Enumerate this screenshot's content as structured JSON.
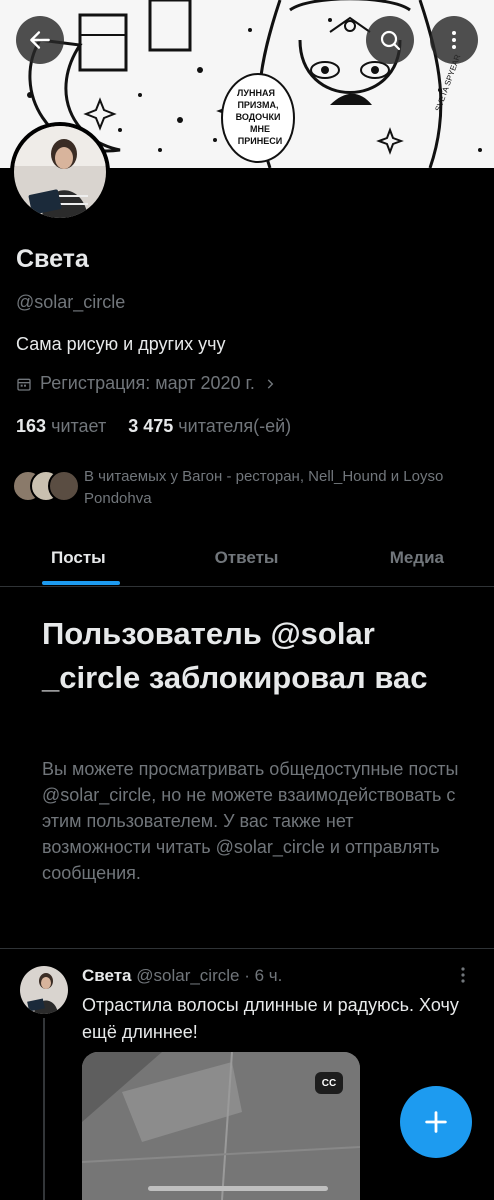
{
  "banner": {
    "speech_text": [
      "ЛУННАЯ",
      "ПРИЗМА,",
      "ВОДОЧКИ",
      "МНЕ",
      "ПРИНЕСИ"
    ],
    "artist_signature": "SVETA SPYEAR"
  },
  "profile": {
    "name": "Света",
    "handle": "@solar_circle",
    "bio": "Сама рисую и других учу",
    "joined": "Регистрация: март 2020 г.",
    "following_count": "163",
    "following_label": "читает",
    "followers_count": "3 475",
    "followers_label": "читателя(-ей)",
    "followers_you_know": "В читаемых у Вагон - ресторан, Nell_Hound и Loyso Pondohva"
  },
  "tabs": [
    {
      "label": "Посты",
      "active": true
    },
    {
      "label": "Ответы",
      "active": false
    },
    {
      "label": "Медиа",
      "active": false
    }
  ],
  "blocked": {
    "title": "Пользователь @solar _circle заблокировал вас",
    "description": "Вы можете просматривать общедоступные посты @solar_circle, но не можете взаимодействовать с этим пользователем. У вас также нет возможности читать @solar_circle и отправлять сообщения."
  },
  "post": {
    "author": "Света",
    "meta": "@solar_circle · 6 ч.",
    "text": "Отрастила волосы длинные и радуюсь. Хочу ещё длиннее!",
    "cc_label": "CC"
  },
  "colors": {
    "accent": "#1d9bf0",
    "background": "#000000",
    "text_primary": "#e7e9ea",
    "text_secondary": "#71767b"
  },
  "icons": [
    "back-arrow-icon",
    "search-icon",
    "more-vertical-icon",
    "calendar-icon",
    "chevron-right-icon",
    "more-vertical-icon",
    "closed-captions-icon",
    "plus-icon"
  ]
}
